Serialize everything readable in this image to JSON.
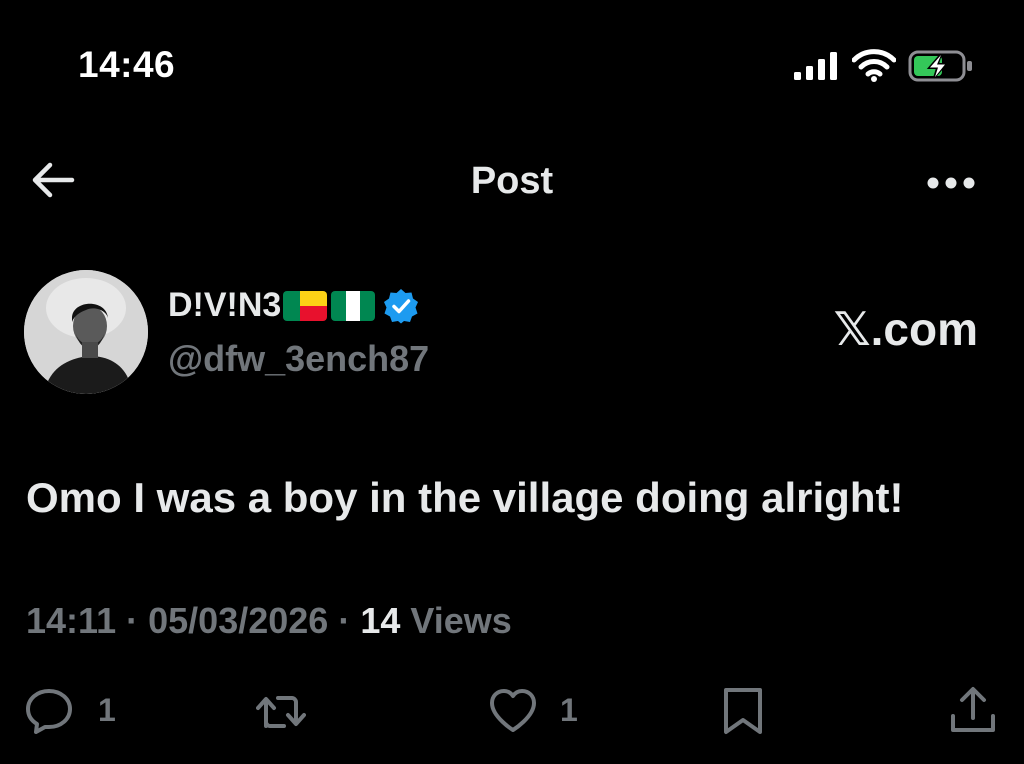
{
  "status_bar": {
    "time": "14:46"
  },
  "nav": {
    "title": "Post"
  },
  "author": {
    "display_name": "D!V!N3",
    "handle": "@dfw_3ench87",
    "flags": [
      "benin-flag",
      "nigeria-flag"
    ],
    "verified": true
  },
  "brand": "𝕏.com",
  "post": {
    "text": "Omo I was a boy in the village doing alright!",
    "time": "14:11",
    "separator": "·",
    "date": "05/03/2026",
    "views_count": "14",
    "views_label": "Views"
  },
  "actions": {
    "reply_count": "1",
    "like_count": "1"
  },
  "colors": {
    "background": "#000000",
    "text": "#e7e9ea",
    "muted": "#71767b",
    "verified": "#1d9bf0",
    "battery_charge": "#34c759"
  },
  "icons": [
    "back-arrow-icon",
    "more-icon",
    "reply-icon",
    "repost-icon",
    "like-icon",
    "bookmark-icon",
    "share-icon",
    "signal-icon",
    "wifi-icon",
    "battery-icon",
    "verified-icon"
  ]
}
